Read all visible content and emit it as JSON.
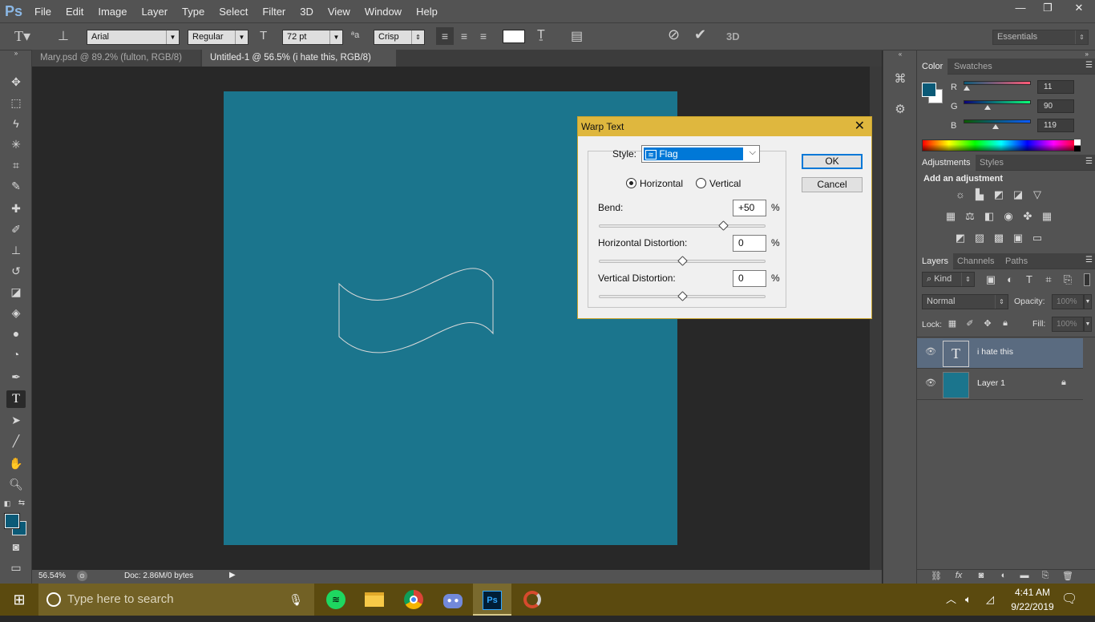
{
  "app": {
    "logo": "Ps"
  },
  "menu": [
    "File",
    "Edit",
    "Image",
    "Layer",
    "Type",
    "Select",
    "Filter",
    "3D",
    "View",
    "Window",
    "Help"
  ],
  "window_controls": {
    "minimize": "—",
    "restore": "❐",
    "close": "✕"
  },
  "options_bar": {
    "font_family": "Arial",
    "font_style": "Regular",
    "font_size": "72 pt",
    "antialias": "Crisp",
    "workspace": "Essentials",
    "three_d": "3D"
  },
  "tabs": [
    {
      "label": "Mary.psd @ 89.2% (fulton, RGB/8)",
      "close": "×"
    },
    {
      "label": "Untitled-1 @ 56.5% (i hate this, RGB/8) *",
      "close": "×"
    }
  ],
  "status": {
    "zoom": "56.54%",
    "doc": "Doc: 2.86M/0 bytes"
  },
  "color_panel": {
    "tabs": [
      "Color",
      "Swatches"
    ],
    "r_label": "R",
    "g_label": "G",
    "b_label": "B",
    "r": "11",
    "g": "90",
    "b": "119",
    "r_level": 0.043,
    "g_level": 0.353,
    "b_level": 0.467,
    "foreground": "#0b5a77",
    "background": "#ffffff"
  },
  "adjustments": {
    "tabs": [
      "Adjustments",
      "Styles"
    ],
    "heading": "Add an adjustment"
  },
  "layers_panel": {
    "tabs": [
      "Layers",
      "Channels",
      "Paths"
    ],
    "kind": "Kind",
    "blend": "Normal",
    "opacity_label": "Opacity:",
    "opacity": "100%",
    "lock_label": "Lock:",
    "fill_label": "Fill:",
    "fill": "100%",
    "layers": [
      {
        "name": "i hate this",
        "type": "text"
      },
      {
        "name": "Layer 1",
        "type": "pixel"
      }
    ]
  },
  "dialog": {
    "title": "Warp Text",
    "close": "✕",
    "style_label": "Style:",
    "style_value": "Flag",
    "horizontal": "Horizontal",
    "vertical": "Vertical",
    "bend_label": "Bend:",
    "bend": "+50",
    "bend_level": 0.75,
    "hdist_label": "Horizontal Distortion:",
    "hdist": "0",
    "hdist_level": 0.5,
    "vdist_label": "Vertical Distortion:",
    "vdist": "0",
    "vdist_level": 0.5,
    "pct": "%",
    "ok": "OK",
    "cancel": "Cancel"
  },
  "taskbar": {
    "search_placeholder": "Type here to search",
    "time": "4:41 AM",
    "date": "9/22/2019"
  },
  "colors": {
    "canvas": "#1b758d",
    "dialog_title": "#dfb73e",
    "taskbar": "#5b4a0f"
  }
}
